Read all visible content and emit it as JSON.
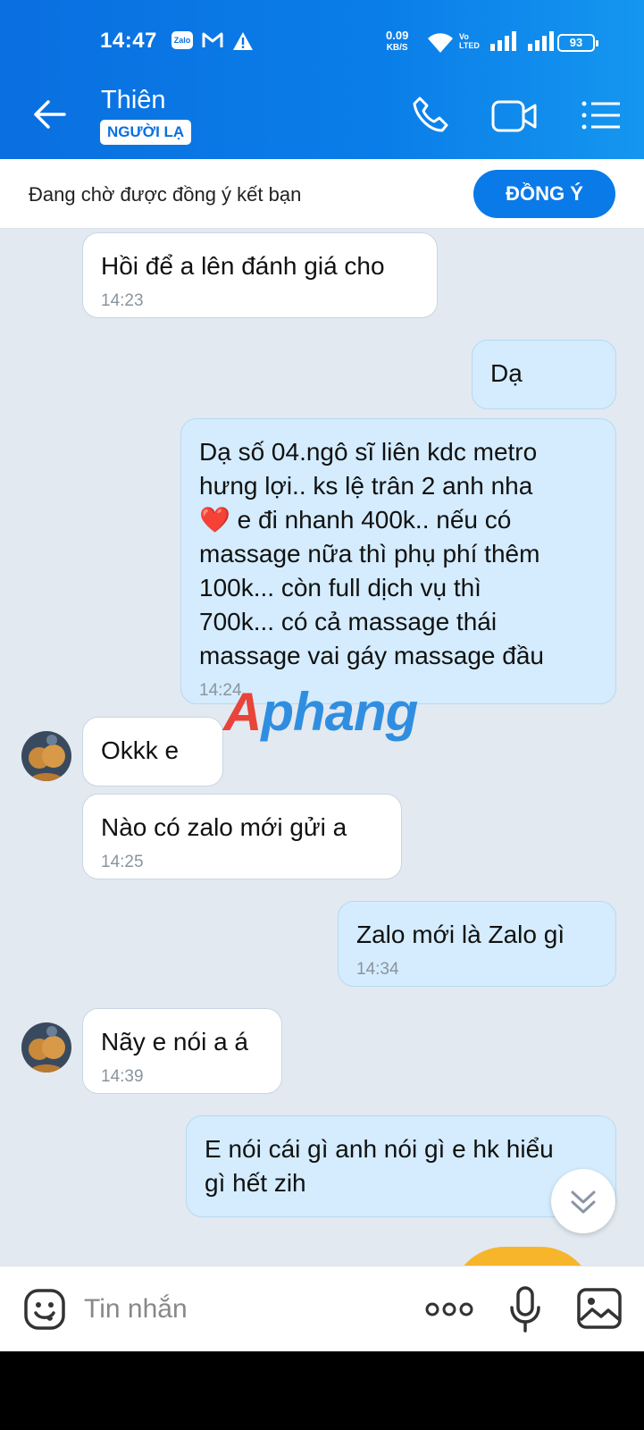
{
  "status_bar": {
    "time": "14:47",
    "zalo_badge": "Zalo",
    "net_speed": "0.09",
    "net_unit": "KB/S",
    "volte_top": "Vo",
    "volte_bottom": "LTED",
    "battery": "93"
  },
  "header": {
    "contact_name": "Thiên",
    "tag": "NGƯỜI LẠ"
  },
  "friend_request": {
    "text": "Đang chờ được đồng ý kết bạn",
    "button": "ĐỒNG Ý"
  },
  "messages": [
    {
      "side": "in",
      "text": "Hồi để a lên đánh giá cho",
      "time": "14:23"
    },
    {
      "side": "out",
      "text": "Dạ",
      "time": ""
    },
    {
      "side": "out",
      "text": "Dạ số 04.ngô sĩ liên kdc metro\nhưng lợi.. ks lệ trân 2 anh nha\n❤️ e đi nhanh 400k.. nếu có\nmassage nữa thì phụ phí thêm\n100k... còn full dịch vụ thì\n700k... có cả massage thái\nmassage vai gáy massage đầu",
      "time": "14:24"
    },
    {
      "side": "in",
      "text": "Okkk e",
      "time": ""
    },
    {
      "side": "in",
      "text": "Nào có zalo mới gửi a",
      "time": "14:25"
    },
    {
      "side": "out",
      "text": "Zalo mới là Zalo gì",
      "time": "14:34"
    },
    {
      "side": "in",
      "text": "Nãy e nói a á",
      "time": "14:39"
    },
    {
      "side": "out",
      "text": "E nói cái gì anh nói gì e hk hiểu\ngì hết zih",
      "time": ""
    }
  ],
  "watermark": {
    "part1": "A",
    "part2": "phang"
  },
  "input": {
    "placeholder": "Tin nhắn"
  },
  "colors": {
    "brand": "#0a7ae8",
    "outgoing_bubble": "#d4ecfd",
    "chat_bg": "#e2e9f1"
  },
  "icons": [
    "back-arrow-icon",
    "phone-icon",
    "video-camera-icon",
    "menu-list-icon",
    "emoji-icon",
    "more-dots-icon",
    "microphone-icon",
    "gallery-icon",
    "chevron-down-icon"
  ]
}
